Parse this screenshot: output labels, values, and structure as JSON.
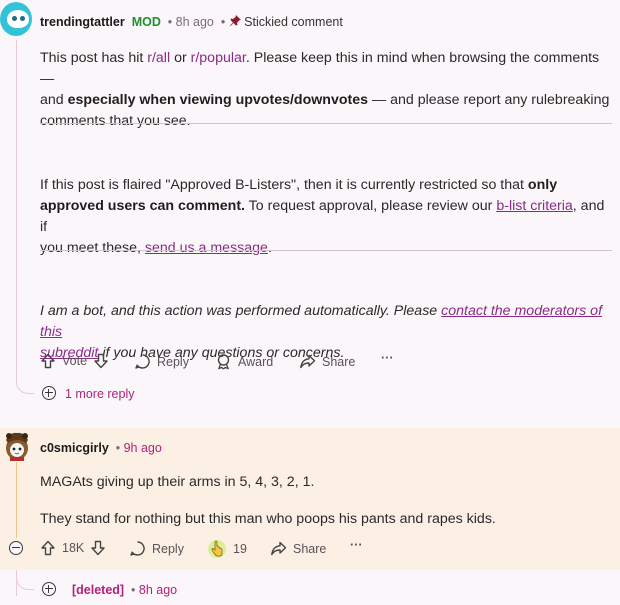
{
  "comment1": {
    "username": "trendingtattler",
    "mod_badge": "MOD",
    "time": "8h ago",
    "sticky_label": "Stickied comment",
    "p1": {
      "t1": "This post has hit ",
      "link1": "r/all",
      "t2": " or ",
      "link2": "r/popular",
      "t3": ". Please keep this in mind when browsing the comments —",
      "t4": "and ",
      "bold": "especially when viewing upvotes/downvotes",
      "t5": " — and please report any rulebreaking",
      "t6": "comments that you see."
    },
    "p2": {
      "t1": "If this post is flaired \"Approved B-Listers\", then it is currently restricted so that ",
      "bold1": "only",
      "bold2": "approved users can comment.",
      "t2": " To request approval, please review our ",
      "link1": "b-list criteria",
      "t3": ", and if",
      "t4": "you meet these, ",
      "link2": "send us a message",
      "t5": "."
    },
    "p3": {
      "t1": "I am a bot, and this action was performed automatically. Please ",
      "link1a": "contact the moderators of this",
      "link1b": "subreddit",
      "t2": " if you have any questions or concerns."
    },
    "actions": {
      "vote": "Vote",
      "reply": "Reply",
      "award": "Award",
      "share": "Share",
      "more": "···"
    },
    "more_replies": "1 more reply"
  },
  "comment2": {
    "username": "c0smicgirly",
    "time": "9h ago",
    "line1": "MAGAts giving up their arms in 5, 4, 3, 2, 1.",
    "line2": "They stand for nothing but this man who poops his pants and rapes kids.",
    "actions": {
      "votes": "18K",
      "reply": "Reply",
      "award_count": "19",
      "share": "Share",
      "more": "···"
    }
  },
  "comment3": {
    "username": "[deleted]",
    "time": "8h ago"
  },
  "colors": {
    "background": "#fbf6f9",
    "mod_green": "#1f8f2f",
    "link_purple": "#8a2b8a",
    "highlight": "#fcf0e4"
  }
}
